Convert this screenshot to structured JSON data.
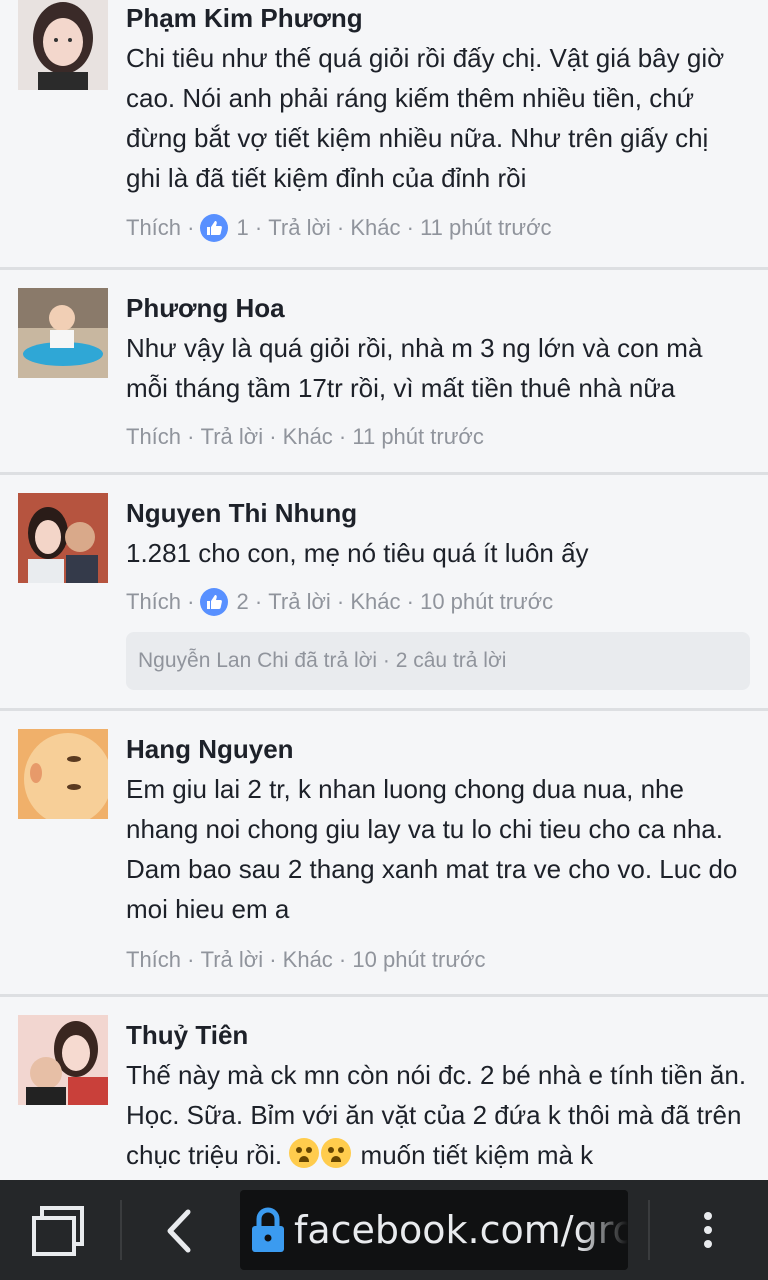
{
  "comments": [
    {
      "name": "Phạm Kim Phương",
      "text": "Chi tiêu như thế quá giỏi rồi đấy chị. Vật giá bây giờ cao. Nói anh phải ráng kiếm thêm nhiều tiền, chứ đừng bắt vợ tiết kiệm nhiều nữa. Như trên giấy chị ghi là đã tiết kiệm đỉnh của đỉnh rồi",
      "like": "Thích",
      "reaction_count": "1",
      "reply": "Trả lời",
      "more": "Khác",
      "time": "11 phút trước"
    },
    {
      "name": "Phương Hoa",
      "text": "Như vậy là quá giỏi rồi, nhà m 3 ng lớn và con mà mỗi tháng tầm 17tr rồi, vì mất tiền thuê nhà nữa",
      "like": "Thích",
      "reply": "Trả lời",
      "more": "Khác",
      "time": "11 phút trước"
    },
    {
      "name": "Nguyen Thi Nhung",
      "text": "1.281 cho con, mẹ nó tiêu quá ít luôn ấy",
      "like": "Thích",
      "reaction_count": "2",
      "reply": "Trả lời",
      "more": "Khác",
      "time": "10 phút trước",
      "replies_summary": "Nguyễn Lan Chi đã trả lời · 2 câu trả lời"
    },
    {
      "name": "Hang Nguyen",
      "text": "Em giu lai 2 tr, k nhan luong chong dua nua, nhe nhang noi chong giu lay va tu lo chi tieu cho ca nha. Dam bao sau 2 thang xanh mat tra ve cho vo. Luc do moi hieu em a",
      "like": "Thích",
      "reply": "Trả lời",
      "more": "Khác",
      "time": "10 phút trước"
    },
    {
      "name": "Thuỷ Tiên",
      "text_before": "Thế này mà ck mn còn nói đc. 2 bé nhà e tính tiền ăn. Học. Sữa. Bỉm với ăn vặt của 2 đứa k thôi mà đã trên chục triệu rồi.",
      "text_after": "muốn tiết kiệm mà k"
    }
  ],
  "icons": {
    "like": "thumbs-up-icon",
    "emoji": "crying-face-icon",
    "tabs": "tabs-icon",
    "back": "back-arrow-icon",
    "lock": "lock-icon",
    "menu": "more-vertical-icon"
  },
  "colors": {
    "like_blue": "#5890ff",
    "meta_gray": "#90949c",
    "lock_blue": "#3b9bf0"
  },
  "browser": {
    "url": "facebook.com/gro"
  }
}
